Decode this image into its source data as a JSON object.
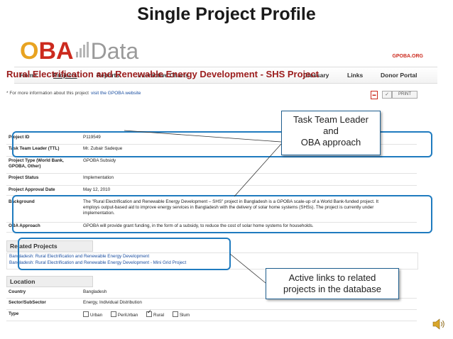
{
  "slide": {
    "title": "Single Project Profile"
  },
  "header": {
    "logo": {
      "o": "O",
      "b": "B",
      "a": "A",
      "data": "Data"
    },
    "site_link": "GPOBA.ORG"
  },
  "nav": {
    "left": [
      "Home",
      "Projects",
      "Reports",
      "Interactive Charts"
    ],
    "right": [
      "Glossary",
      "Links",
      "Donor Portal"
    ],
    "active": "Projects"
  },
  "project": {
    "title": "Rural Electrification and Renewable Energy Development - SHS Project",
    "more_info_text": "* For more information about this project",
    "more_info_link": "visit the GPOBA website",
    "print_label": "PRINT"
  },
  "details": [
    {
      "label": "Project ID",
      "value": "P119549"
    },
    {
      "label": "Task Team Leader (TTL)",
      "value": "Mr. Zubair Sadeque"
    },
    {
      "label": "Project Type (World Bank, GPOBA, Other)",
      "value": "GPOBA Subsidy"
    },
    {
      "label": "Project Status",
      "value": "Implementation"
    },
    {
      "label": "Project Approval Date",
      "value": "May 12, 2010"
    },
    {
      "label": "Background",
      "value": "The \"Rural Electrification and Renewable Energy Development – SHS\" project in Bangladesh is a GPOBA scale-up of a World Bank-funded project. It employs output-based aid to improve energy services in Bangladesh with the delivery of solar home systems (SHSs). The project is currently under implementation."
    },
    {
      "label": "OBA Approach",
      "value": "GPOBA will provide grant funding, in the form of a subsidy, to reduce the cost of solar home systems for households."
    }
  ],
  "related": {
    "heading": "Related Projects",
    "links": [
      "Bangladesh: Rural Electrification and Renewable Energy Development",
      "Bangladesh: Rural Electrification and Renewable Energy Development - Mini Grid Project"
    ]
  },
  "location": {
    "heading": "Location",
    "rows": [
      {
        "label": "Country",
        "value": "Bangladesh"
      },
      {
        "label": "Sector/SubSector",
        "value": "Energy, Individual Distribution"
      }
    ],
    "type_label": "Type",
    "type_options": [
      {
        "label": "Urban",
        "checked": false
      },
      {
        "label": "PeriUrban",
        "checked": false
      },
      {
        "label": "Rural",
        "checked": true
      },
      {
        "label": "Slum",
        "checked": false
      }
    ]
  },
  "callouts": {
    "ttl": [
      "Task Team Leader",
      "and",
      "OBA approach"
    ],
    "links": [
      "Active links to related",
      "projects in the database"
    ]
  },
  "colors": {
    "highlight": "#1f7bbf",
    "title_red": "#9b1c1c",
    "link_blue": "#1a4ea0"
  },
  "icons": [
    "pdf-icon",
    "check-icon",
    "speaker-icon"
  ]
}
